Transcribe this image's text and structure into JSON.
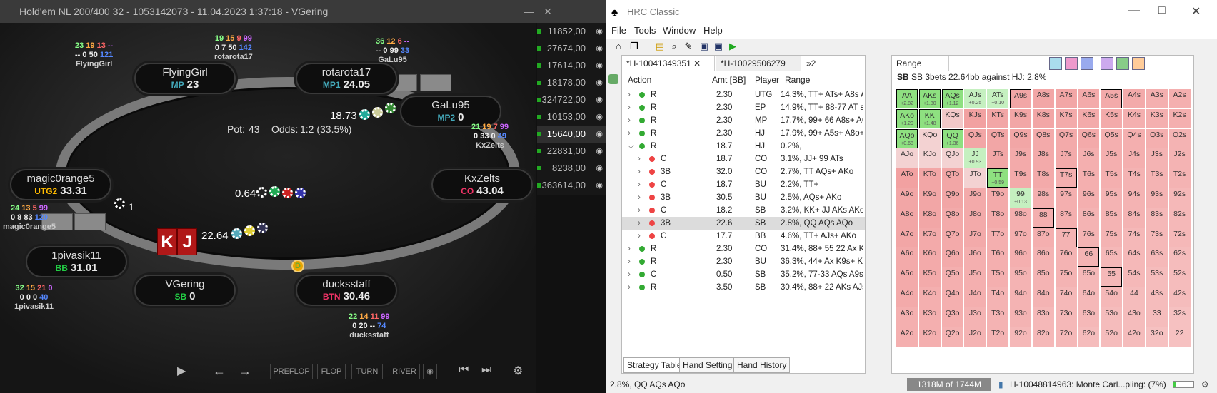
{
  "poker": {
    "title": "Hold'em NL 200/400 32 - 1053142073 - 11.04.2023 1:37:18 - VGering",
    "pot_label": "Pot:",
    "pot_value": "43",
    "odds_label": "Odds:",
    "odds_value": "1:2 (33.5%)",
    "hero_cards": [
      "K",
      "J"
    ],
    "hero_bet": "22.64",
    "sb_bet": "0.64",
    "gal_bet": "18.73",
    "other_marker": "1",
    "players": [
      {
        "name": "FlyingGirl",
        "pos": "MP",
        "stack": "23",
        "posColor": "#4ab",
        "s1": [
          "23",
          "19",
          "13",
          "--"
        ],
        "s2": [
          "--",
          "0",
          "50",
          "121"
        ],
        "label": "FlyingGirl"
      },
      {
        "name": "rotarota17",
        "pos": "MP1",
        "stack": "24.05",
        "posColor": "#4ab",
        "s1": [
          "19",
          "15",
          "9",
          "99"
        ],
        "s2": [
          "0",
          "7",
          "50",
          "142"
        ],
        "label": "rotarota17"
      },
      {
        "name": "GaLu95",
        "pos": "MP2",
        "stack": "0",
        "posColor": "#4ab",
        "s1": [
          "36",
          "12",
          "6",
          "--"
        ],
        "s2": [
          "--",
          "0",
          "99",
          "33"
        ],
        "label": "GaLu95"
      },
      {
        "name": "KxZelts",
        "pos": "CO",
        "stack": "43.04",
        "posColor": "#e36",
        "s1": [
          "21",
          "19",
          "7",
          "99"
        ],
        "s2": [
          "0",
          "33",
          "0",
          "49"
        ],
        "label": "KxZelts"
      },
      {
        "name": "magic0range5",
        "pos": "UTG2",
        "stack": "33.31",
        "posColor": "#fb0",
        "s1": [
          "24",
          "13",
          "5",
          "99"
        ],
        "s2": [
          "0",
          "8",
          "83",
          "120"
        ],
        "label": "magic0range5"
      },
      {
        "name": "1pivasik11",
        "pos": "BB",
        "stack": "31.01",
        "posColor": "#2c4",
        "s1": [
          "32",
          "15",
          "21",
          "0"
        ],
        "s2": [
          "0",
          "0",
          "0",
          "40"
        ],
        "label": "1pivasik11"
      },
      {
        "name": "VGering",
        "pos": "SB",
        "stack": "0",
        "posColor": "#2c4",
        "label": ""
      },
      {
        "name": "ducksstaff",
        "pos": "BTN",
        "stack": "30.46",
        "posColor": "#e36",
        "s1": [
          "22",
          "14",
          "11",
          "99"
        ],
        "s2": [
          "0",
          "20",
          "--",
          "74"
        ],
        "label": "ducksstaff"
      }
    ],
    "stacks": [
      "11852,00",
      "27674,00",
      "17614,00",
      "18178,00",
      "324722,00",
      "10153,00",
      "15640,00",
      "22831,00",
      "8238,00",
      "363614,00"
    ],
    "controls": [
      "PREFLOP",
      "FLOP",
      "TURN",
      "RIVER"
    ]
  },
  "hrc": {
    "title": "HRC Classic",
    "menu": [
      "File",
      "Tools",
      "Window",
      "Help"
    ],
    "tabs": [
      "*H-10041349351",
      "*H-10029506279",
      "»2"
    ],
    "range_tab": "Range",
    "cols": [
      "Action",
      "Amt [BB]",
      "Player",
      "Range"
    ],
    "rows": [
      {
        "a": "R",
        "amt": "2.30",
        "p": "UTG",
        "r": "14.3%, TT+ ATs+ A8s A6s",
        "d": "#3a3",
        "ind": 0
      },
      {
        "a": "R",
        "amt": "2.30",
        "p": "EP",
        "r": "14.9%, TT+ 88-77 AT s+ A6",
        "d": "#3a3",
        "ind": 0
      },
      {
        "a": "R",
        "amt": "2.30",
        "p": "MP",
        "r": "17.7%, 99+ 66 A8s+ A6s",
        "d": "#3a3",
        "ind": 0
      },
      {
        "a": "R",
        "amt": "2.30",
        "p": "HJ",
        "r": "17.9%, 99+ A5s+ A8o+ A",
        "d": "#3a3",
        "ind": 0
      },
      {
        "a": "R",
        "amt": "18.7",
        "p": "HJ",
        "r": "0.2%,",
        "d": "#3a3",
        "ind": 0,
        "open": true
      },
      {
        "a": "C",
        "amt": "18.7",
        "p": "CO",
        "r": "3.1%, JJ+ 99 ATs",
        "d": "#e44",
        "ind": 1
      },
      {
        "a": "3B",
        "amt": "32.0",
        "p": "CO",
        "r": "2.7%, TT AQs+ AKo",
        "d": "#e44",
        "ind": 1
      },
      {
        "a": "C",
        "amt": "18.7",
        "p": "BU",
        "r": "2.2%, TT+",
        "d": "#e44",
        "ind": 1
      },
      {
        "a": "3B",
        "amt": "30.5",
        "p": "BU",
        "r": "2.5%, AQs+ AKo",
        "d": "#e44",
        "ind": 1
      },
      {
        "a": "C",
        "amt": "18.2",
        "p": "SB",
        "r": "3.2%, KK+ JJ AKs AKo",
        "d": "#e44",
        "ind": 1
      },
      {
        "a": "3B",
        "amt": "22.6",
        "p": "SB",
        "r": "2.8%, QQ AQs AQo",
        "d": "#e44",
        "ind": 1,
        "sel": true
      },
      {
        "a": "C",
        "amt": "17.7",
        "p": "BB",
        "r": "4.6%, TT+ AJs+ AKo",
        "d": "#e44",
        "ind": 1
      },
      {
        "a": "R",
        "amt": "2.30",
        "p": "CO",
        "r": "31.4%, 88+ 55 22 Ax K7s",
        "d": "#3a3",
        "ind": 0
      },
      {
        "a": "R",
        "amt": "2.30",
        "p": "BU",
        "r": "36.3%, 44+ Ax K9s+ K7s",
        "d": "#3a3",
        "ind": 0
      },
      {
        "a": "C",
        "amt": "0.50",
        "p": "SB",
        "r": "35.2%, 77-33 AQs A9s-A",
        "d": "#3a3",
        "ind": 0
      },
      {
        "a": "R",
        "amt": "3.50",
        "p": "SB",
        "r": "30.4%, 88+ 22 AKs AJs-A",
        "d": "#3a3",
        "ind": 0
      }
    ],
    "bottom_tabs": [
      "Strategy Table",
      "Hand Settings",
      "Hand History"
    ],
    "range_header": "SB 3bets 22.64bb against HJ: 2.8%",
    "status_left": "2.8%, QQ AQs AQo",
    "memory": "1318M of 1744M",
    "status_right": "H-10048814963: Monte Carl...pling: (7%)"
  }
}
